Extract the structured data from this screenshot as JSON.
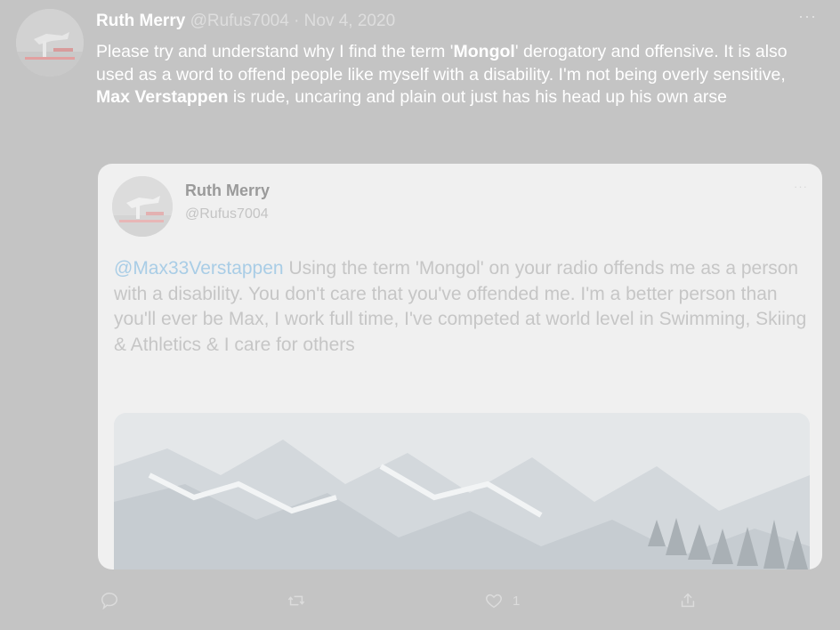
{
  "tweet": {
    "author_name": "Ruth Merry",
    "handle": "@Rufus7004",
    "separator": "·",
    "date": "Nov 4, 2020",
    "more_label": "···",
    "text_1": "Please try and understand why I find the term '",
    "bold_1": "Mongol",
    "text_2": "' derogatory and offensive. It is also used as a word to offend people like myself with a disability. I'm not being overly sensitive, ",
    "bold_2": "Max Verstappen",
    "text_3": " is rude, uncaring and plain out just has his head up his own arse"
  },
  "quoted": {
    "author_name": "Ruth Merry",
    "handle": "@Rufus7004",
    "more_label": "···",
    "mention": "@Max33Verstappen",
    "text": " Using the term 'Mongol' on your radio offends me as a person with a disability. You don't care that you've offended me. I'm a better person than you'll ever be Max, I work full time, I've competed at world level in Swimming, Skiing & Athletics & I care for others"
  },
  "actions": {
    "reply_icon": "reply-icon",
    "retweet_icon": "retweet-icon",
    "like_icon": "heart-icon",
    "like_count": "1",
    "share_icon": "share-icon"
  },
  "colors": {
    "overlay_background": "#c4c4c4",
    "mention": "#a9cde6",
    "quote_card": "#f0f0f0"
  }
}
